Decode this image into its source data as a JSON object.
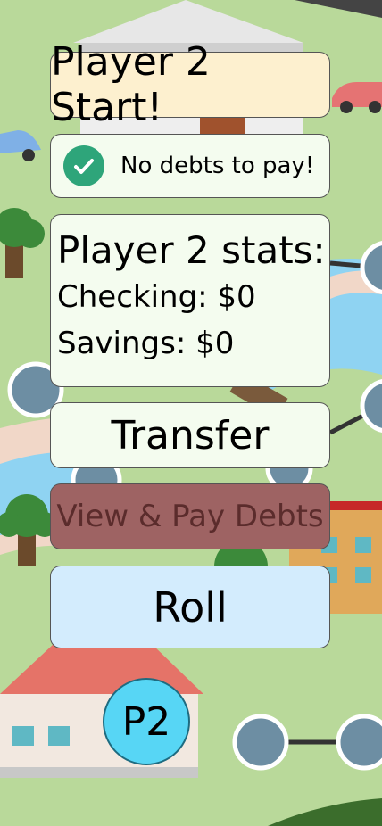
{
  "turn": {
    "banner": "Player 2 Start!"
  },
  "debts": {
    "status": "No debts to pay!",
    "icon": "check-circle-icon"
  },
  "stats": {
    "title": "Player 2 stats:",
    "checking": "Checking: $0",
    "savings": "Savings: $0"
  },
  "actions": {
    "transfer": "Transfer",
    "view_debts": "View & Pay Debts",
    "roll": "Roll"
  },
  "player_token": {
    "label": "P2",
    "color": "#57d6f5"
  },
  "colors": {
    "grass": "#b9d99a",
    "water": "#8fd3f2",
    "path": "#f1d7c8",
    "node": "#6d8ea3"
  }
}
